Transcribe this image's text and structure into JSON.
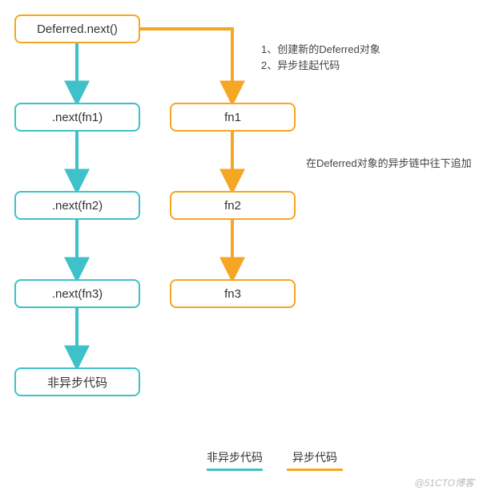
{
  "chart_data": {
    "type": "flowchart",
    "columns": {
      "left": {
        "color": "teal",
        "meaning": "非异步代码",
        "nodes": [
          "Deferred.next()",
          ".next(fn1)",
          ".next(fn2)",
          ".next(fn3)",
          "非异步代码"
        ]
      },
      "right": {
        "color": "orange",
        "meaning": "异步代码",
        "nodes": [
          "fn1",
          "fn2",
          "fn3"
        ]
      }
    },
    "edges": [
      {
        "from": "Deferred.next()",
        "to": ".next(fn1)",
        "color": "teal"
      },
      {
        "from": ".next(fn1)",
        "to": ".next(fn2)",
        "color": "teal"
      },
      {
        "from": ".next(fn2)",
        "to": ".next(fn3)",
        "color": "teal"
      },
      {
        "from": ".next(fn3)",
        "to": "非异步代码",
        "color": "teal"
      },
      {
        "from": "Deferred.next()",
        "to": "fn1",
        "color": "orange",
        "annotation": [
          "1、创建新的Deferred对象",
          "2、异步挂起代码"
        ]
      },
      {
        "from": "fn1",
        "to": "fn2",
        "color": "orange",
        "annotation": [
          "在Deferred对象的异步链中往下追加"
        ]
      },
      {
        "from": "fn2",
        "to": "fn3",
        "color": "orange"
      }
    ]
  },
  "boxes": {
    "start": "Deferred.next()",
    "l1": ".next(fn1)",
    "l2": ".next(fn2)",
    "l3": ".next(fn3)",
    "lend": "非异步代码",
    "r1": "fn1",
    "r2": "fn2",
    "r3": "fn3"
  },
  "notes": {
    "n1a": "1、创建新的Deferred对象",
    "n1b": "2、异步挂起代码",
    "n2": "在Deferred对象的异步链中往下追加"
  },
  "legend": {
    "teal": "非异步代码",
    "orange": "异步代码"
  },
  "watermark": "@51CTO博客"
}
